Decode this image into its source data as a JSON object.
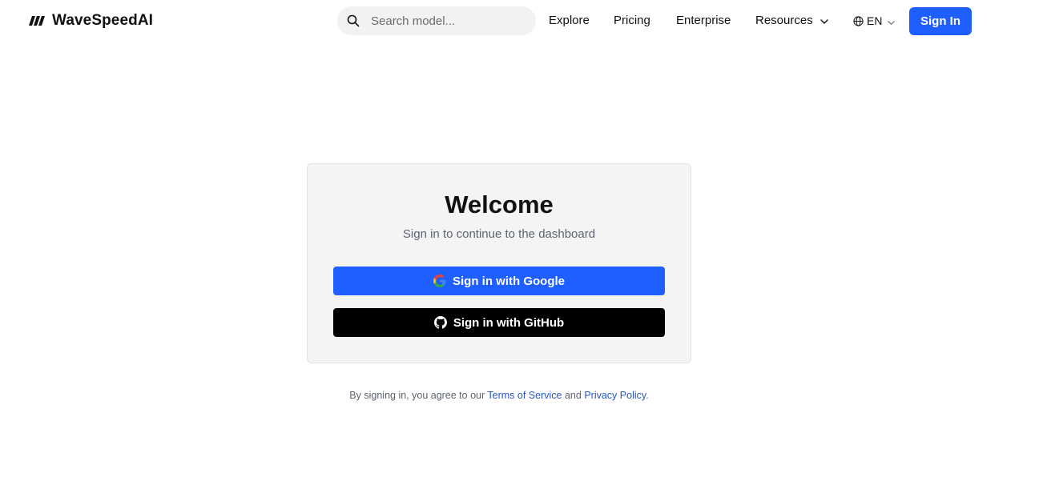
{
  "header": {
    "logo_text": "WaveSpeedAI",
    "search": {
      "placeholder": "Search model...",
      "value": ""
    },
    "nav": {
      "explore": "Explore",
      "pricing": "Pricing",
      "enterprise": "Enterprise",
      "resources": "Resources"
    },
    "language": "EN",
    "sign_in_label": "Sign In",
    "icons": [
      "logo-icon",
      "search-icon",
      "chevron-down-icon",
      "globe-icon"
    ]
  },
  "login_card": {
    "title": "Welcome",
    "subtitle": "Sign in to continue to the dashboard",
    "google_label": "Sign in with Google",
    "github_label": "Sign in with GitHub",
    "icons": [
      "google-icon",
      "github-icon"
    ]
  },
  "terms": {
    "prefix": "By signing in, you agree to our",
    "terms_link": "Terms of Service",
    "conjunction": "and",
    "privacy_link": "Privacy Policy",
    "suffix": "."
  },
  "colors": {
    "accent": "#1f5eff",
    "github_button": "#000000",
    "card_background": "#f4f4f5",
    "link": "#2656c9"
  }
}
